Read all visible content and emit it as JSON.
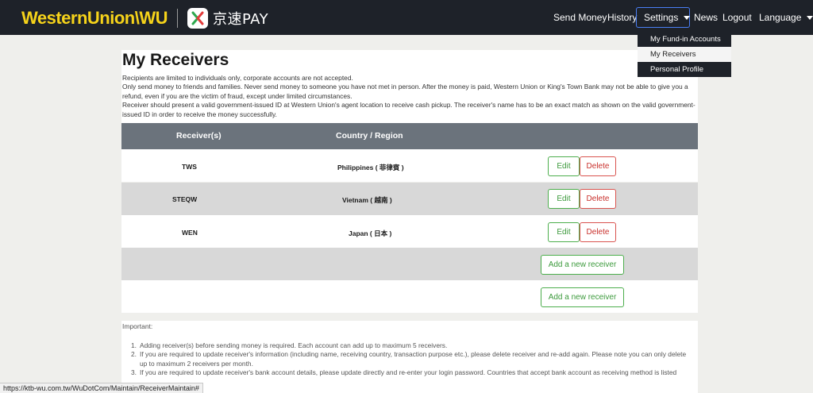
{
  "brand": {
    "wu_logo": "WesternUnion\\WU",
    "pay_text": "京速PAY"
  },
  "nav": {
    "send_money": "Send Money",
    "history": "History",
    "settings": "Settings",
    "news": "News",
    "logout": "Logout",
    "language": "Language"
  },
  "settings_menu": {
    "items": [
      {
        "label": "My Fund-in Accounts",
        "active": false
      },
      {
        "label": "My Receivers",
        "active": true
      },
      {
        "label": "Personal Profile",
        "active": false
      }
    ]
  },
  "page": {
    "title": "My Receivers",
    "intro_lines": [
      "Recipients are limited to individuals only, corporate accounts are not accepted.",
      "Only send money to friends and families. Never send money to someone you have not met in person. After the money is paid, Western Union or King's Town Bank may not be able to give you a refund, even if you are the victim of fraud, except under limited circumstances.",
      "Receiver should present a valid government-issued ID at Western Union's agent location to receive cash pickup. The receiver's name has to be an exact match as shown on the valid government-issued ID in order to receive the money successfully."
    ]
  },
  "table": {
    "headers": {
      "receiver": "Receiver(s)",
      "country": "Country / Region"
    },
    "rows": [
      {
        "receiver": "TWS",
        "country": "Philippines ( 菲律賓 )",
        "edit": "Edit",
        "delete": "Delete"
      },
      {
        "receiver": "STEQW",
        "country": "Vietnam ( 越南 )",
        "edit": "Edit",
        "delete": "Delete"
      },
      {
        "receiver": "WEN",
        "country": "Japan ( 日本 )",
        "edit": "Edit",
        "delete": "Delete"
      }
    ],
    "add_rows": [
      {
        "add": "Add a new receiver"
      },
      {
        "add": "Add a new receiver"
      }
    ]
  },
  "important": {
    "label": "Important:",
    "items": [
      {
        "num": "1.",
        "text": "Adding receiver(s) before sending money is required. Each account can add up to maximum 5 receivers."
      },
      {
        "num": "2.",
        "text": "If you are required to update receiver's information (including name, receiving country, transaction purpose etc.), please delete receiver and re-add again. Please note you can only delete up to maximum 2 receivers per month."
      },
      {
        "num": "3.",
        "text": "If you are required to update receiver's bank account details, please update directly and re-enter your login password. Countries that accept bank account as receiving method is listed"
      }
    ]
  },
  "status_bar": {
    "url": "https://ktb-wu.com.tw/WuDotCom/Maintain/ReceiverMaintain#"
  },
  "colors": {
    "navbar_bg": "#1e2229",
    "brand_yellow": "#f6d31a",
    "table_header_bg": "#6b737c",
    "edit_green": "#3c9a3c",
    "delete_red": "#c9302c"
  }
}
